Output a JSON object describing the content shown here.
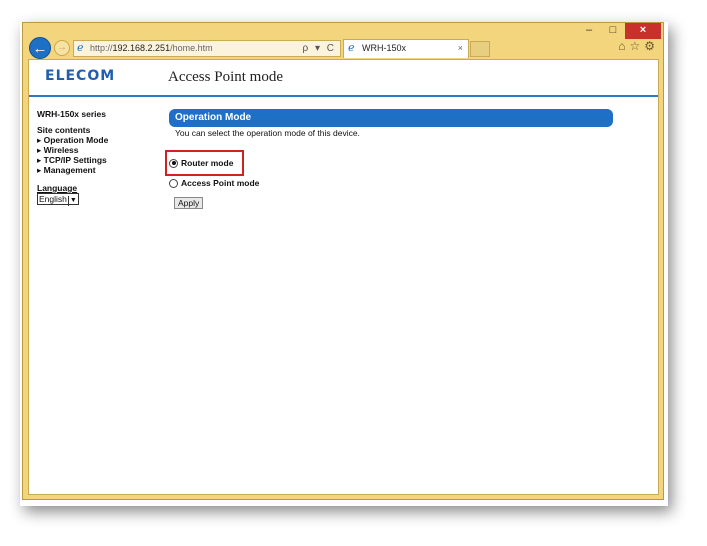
{
  "browser": {
    "url_scheme": "http://",
    "url_host": "192.168.2.251",
    "url_path": "/home.htm",
    "search_controls": "ρ ▾ C",
    "tab_title": "WRH-150x",
    "tab_close": "×",
    "window_controls": {
      "minimize": "–",
      "maximize": "□",
      "close": "×"
    },
    "toolbar_icons": {
      "home": "⌂",
      "favorites": "☆",
      "settings": "⚙"
    }
  },
  "header": {
    "logo": "ELECOM",
    "title": "Access Point mode"
  },
  "sidebar": {
    "model": "WRH-150x series",
    "site_contents": "Site contents",
    "items": [
      {
        "label": "▸ Operation Mode"
      },
      {
        "label": "▸ Wireless"
      },
      {
        "label": "▸ TCP/IP Settings"
      },
      {
        "label": "▸ Management"
      }
    ],
    "language_label": "Language",
    "language_value": "English"
  },
  "main": {
    "section_title": "Operation Mode",
    "description": "You can select the operation mode of this device.",
    "options": [
      {
        "label": "Router mode",
        "selected": true
      },
      {
        "label": "Access Point mode",
        "selected": false
      }
    ],
    "apply_label": "Apply"
  },
  "colors": {
    "accent": "#1e6fc6",
    "highlight": "#d3211f",
    "window_frame": "#f2d57d"
  }
}
